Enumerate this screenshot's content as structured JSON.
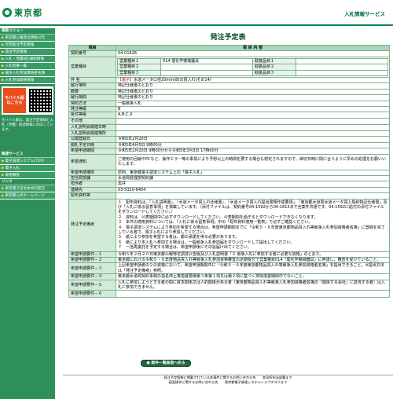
{
  "header": {
    "logo_text": "東京都",
    "service_name": "入札情報サービス"
  },
  "sidebar": {
    "sections": [
      {
        "title": "検索メニュー",
        "items": [
          "東京都公報発注情報公告",
          "年間発注予定情報",
          "発注予定情報",
          "入札・見積(結)通知情報",
          "入札結果一覧",
          "競争入札参加資格者名簿",
          "入札参加資格情報"
        ]
      },
      {
        "title": "関連サービス",
        "items": [
          "電子調達システム(TOP)",
          "電子入札",
          "資格審査"
        ]
      },
      {
        "title": "リンク",
        "items": [
          "東京電子自治体共同運営",
          "東京都公式ホームページ"
        ]
      }
    ],
    "mobile": {
      "label": "モバイル版はこちら",
      "note": "モバイル版は、発注予定情報と入札（見積）経過情報に対応しています。"
    }
  },
  "main": {
    "title": "発注予定表",
    "table": {
      "header_item": "項目",
      "header_content": "項 目 内 容",
      "contract_no_label": "契約番号",
      "contract_no": "04-01626",
      "business_type_label": "営業種目",
      "business_types": [
        {
          "label": "営業種目１",
          "value": "014 理化学機械器具",
          "rank_label": "取扱品目１",
          "rank_value": ""
        },
        {
          "label": "営業種目２",
          "value": "",
          "rank_label": "取扱品目２",
          "rank_value": ""
        },
        {
          "label": "営業種目３",
          "value": "",
          "rank_label": "取扱品目３",
          "rank_value": ""
        }
      ],
      "subject_label": "件 名",
      "subject_tag": "【電子】",
      "subject_text": "水道メータ口径20mm(B)の買入れ(その14)",
      "rows1": [
        {
          "label": "履行場所",
          "value": "特記仕様書のとおり"
        },
        {
          "label": "概要",
          "value": "特記仕様書のとおり"
        },
        {
          "label": "履行期間",
          "value": "特記仕様書のとおり"
        },
        {
          "label": "契約方法",
          "value": "一般競争入札"
        },
        {
          "label": "発注等級",
          "value": "B"
        },
        {
          "label": "受付等級",
          "value": "A,B,C,X"
        },
        {
          "label": "その他",
          "value": ""
        },
        {
          "label": "入札説明会開催日時",
          "value": ""
        },
        {
          "label": "入札説明会開催場所",
          "value": ""
        },
        {
          "label": "公開登録日",
          "value": "令和5年2月20日"
        },
        {
          "label": "開札予定日時",
          "value": "令和5年4月5日 9時00分"
        },
        {
          "label": "希望申請期間",
          "value": "令和5年2月20日 9時00分から令和5年3月3日 17時00分"
        }
      ],
      "request_label": "希望通知",
      "request_text": "ご使用の回線やPCなど、操作エラー等の事情により予想以上の時間を要する場合も想定されますので、締切日時に間に合うように早めの処理をお願いいたします。",
      "rows2": [
        {
          "label": "希望申請場所",
          "value": "原則、東京都電子調達システム上の「電子入札」"
        },
        {
          "label": "担当局部課",
          "value": "水道局経理部契約課"
        },
        {
          "label": "担当者",
          "value": "黒井"
        },
        {
          "label": "連絡先",
          "value": "03-5320-6404"
        },
        {
          "label": "配布資料等",
          "value": ""
        }
      ],
      "notes_label": "発注予定備考",
      "notes": [
        "１　配布資料は、「入札説明書」、「水道メータ買入れ仕様書」、「水道メータ買入れ提出書類作成要領」、「東京都水道局水道メータ買入契約特記仕様書」及び「入札に係る留意事項」を掲載しています。（添付ファイルは、契約番号04-1592から04-1615まで全案件共通です。04-1592に貼付の添付ファイルをダウンロードしてください。）",
        "２　資料は、公表期間中に必ずダウンロードしてください。公表期間を過ぎるとダウンロードできなくなります。",
        "３　本件の適用資料については、「入札に係る留意事項」中の「配布資料適用一覧表」で必ずご確認ください。",
        "４　電子調達システムにより参加を希望する場合は、希望申請期間までに「令和５・６年度東京都物品買入れ等競争入札参加資格者名簿」に登録を完了している者で、電子入札により参加してください。",
        "５　紙により参加を希望する者は、都の承諾を得る必要があります。",
        "６　紙により本入札へ参加する場合は、一般競争入札参加届をダウンロードして提出してください。",
        "７　一括再委託を予定する場合は、希望申請後にその旨届け出てください。"
      ],
      "attachments": [
        {
          "label": "希望申請要件－１",
          "value": "令和５年２月２０日東京都公報特定調達公告版及び入札説明書「２ 競争入札に参加する者に必要な資格」のとおり。"
        },
        {
          "label": "希望申請要件－２",
          "value": "東京都における令和５・６年度物品買入れ等競争入札参加資格審査の定期受付で営業種目014「理化学機械器具」に申請し、審査を受けていること。"
        },
        {
          "label": "希望申請要件－３",
          "value": "上記希望申請者の２の資格において、希望申請期間中に「令和５・６年度東京都物品買入れ等競争入札参加資格者名簿」を提出できること。※提出方法は「発注予定備考」参照。"
        },
        {
          "label": "希望申請要件－４",
          "value": "東京都水道局契約事務の指名停止等措置要綱第３条第１項又は第２項に基づく排除措置期間中でないこと。"
        },
        {
          "label": "希望申請要件－５",
          "value": "入札に参加しようとする者の間に資本関係又は人的関係がある者（東京都物品買入れ等競争入札参加資格者名簿の「関係する会社」に該当する者）は入札に参加できません。"
        },
        {
          "label": "希望申請要件－６",
          "value": ""
        }
      ]
    },
    "back_button": "● 案件一覧画面へ戻る"
  },
  "footer": {
    "line1": "発注予定情報に掲載されている各事件に関するお問い合わせ先　　各局所担当部署まで",
    "line2": "画面操作に関するお問い合わせ先　　東京都電子調達システムヘルプデスクまで"
  }
}
